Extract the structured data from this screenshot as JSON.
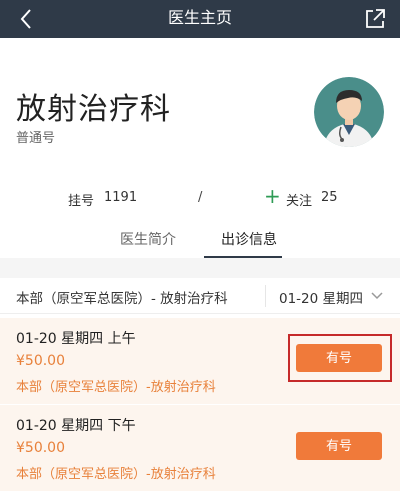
{
  "navbar": {
    "title": "医生主页",
    "back_icon": "chevron-left-icon",
    "share_icon": "share-icon"
  },
  "doctor": {
    "department": "放射治疗科",
    "type": "普通号",
    "avatar_icon": "doctor-avatar-icon"
  },
  "stats": {
    "registration_label": "挂号",
    "registration_count": "1191",
    "separator": "/",
    "follow_label": "关注",
    "follow_count": "25"
  },
  "tabs": [
    {
      "label": "医生简介",
      "active": false
    },
    {
      "label": "出诊信息",
      "active": true
    }
  ],
  "filter": {
    "hospital": "本部（原空军总医院）- 放射治疗科",
    "date": "01-20 星期四"
  },
  "slots": [
    {
      "time": "01-20 星期四 上午",
      "price": "¥50.00",
      "location": "本部（原空军总医院）-放射治疗科",
      "button": "有号"
    },
    {
      "time": "01-20 星期四 下午",
      "price": "¥50.00",
      "location": "本部（原空军总医院）-放射治疗科",
      "button": "有号"
    }
  ],
  "colors": {
    "navbar": "#2f3a48",
    "accent": "#f07a3a",
    "follow": "#2e9b55",
    "highlight_border": "#c52a2a"
  }
}
